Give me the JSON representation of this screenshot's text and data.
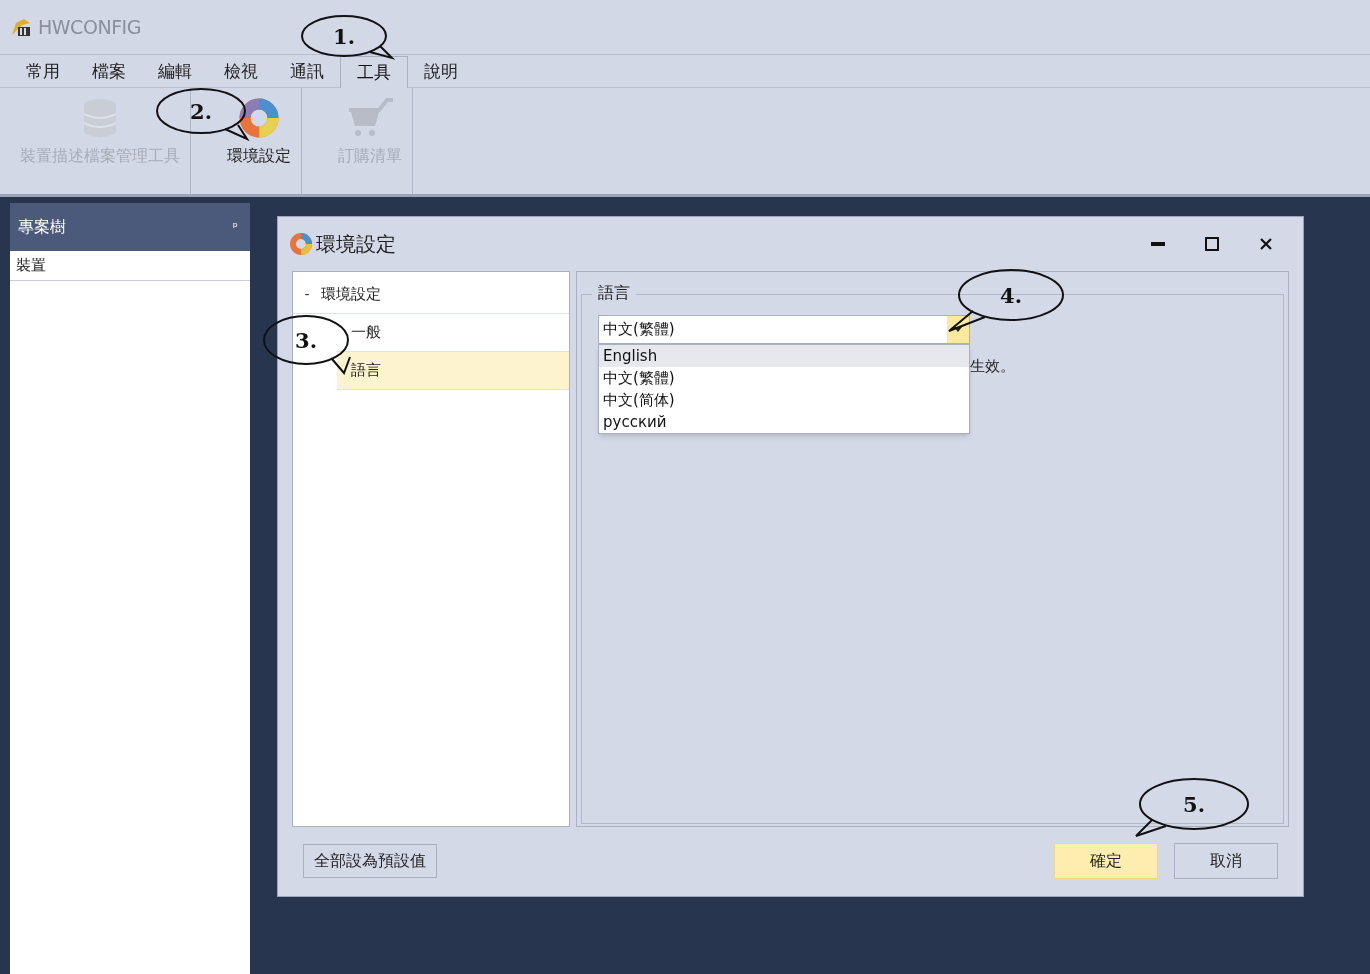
{
  "app": {
    "title": "HWCONFIG"
  },
  "tabs": [
    {
      "label": "常用",
      "selected": false
    },
    {
      "label": "檔案",
      "selected": false
    },
    {
      "label": "編輯",
      "selected": false
    },
    {
      "label": "檢視",
      "selected": false
    },
    {
      "label": "通訊",
      "selected": false
    },
    {
      "label": "工具",
      "selected": true
    },
    {
      "label": "說明",
      "selected": false
    }
  ],
  "ribbon": [
    {
      "kind": "database",
      "label": "裝置描述檔案管理工具",
      "disabled": true
    },
    {
      "kind": "palette",
      "label": "環境設定",
      "disabled": false
    },
    {
      "kind": "cart",
      "label": "訂購清單",
      "disabled": true
    }
  ],
  "project_tree": {
    "title": "專案樹",
    "pin": "ᵖ",
    "items": [
      {
        "label": "裝置"
      }
    ]
  },
  "dialog": {
    "title": "環境設定",
    "tree": [
      {
        "label": "環境設定",
        "toggle": "-",
        "expanded": true,
        "selected": false,
        "children": [
          {
            "label": "一般",
            "selected": false
          },
          {
            "label": "語言",
            "selected": true
          }
        ]
      }
    ],
    "group_title": "語言",
    "dropdown": {
      "value": "中文(繁體)",
      "open": true,
      "options": [
        {
          "label": "English",
          "highlighted": true
        },
        {
          "label": "中文(繁體)",
          "highlighted": false
        },
        {
          "label": "中文(简体)",
          "highlighted": false
        },
        {
          "label": "русский",
          "highlighted": false
        }
      ]
    },
    "note": "生效。",
    "reset_button": "全部設為預設值",
    "buttons": [
      {
        "label": "確定",
        "default": true
      },
      {
        "label": "取消",
        "default": false
      }
    ]
  },
  "callouts": [
    {
      "label": "1."
    },
    {
      "label": "2."
    },
    {
      "label": "3."
    },
    {
      "label": "4."
    },
    {
      "label": "5."
    }
  ]
}
